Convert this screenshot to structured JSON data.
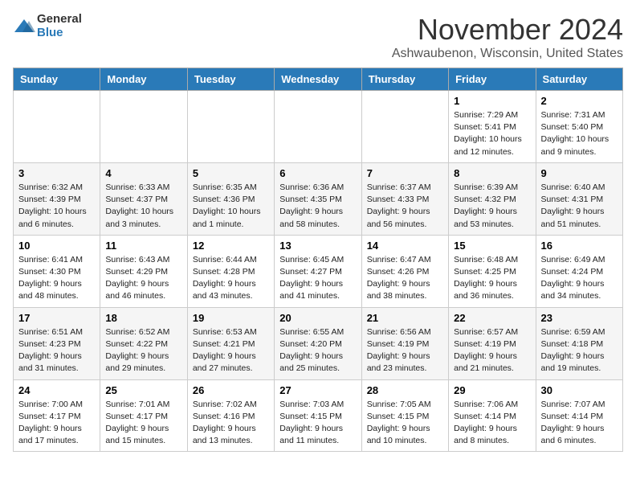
{
  "header": {
    "logo_general": "General",
    "logo_blue": "Blue",
    "month_title": "November 2024",
    "location": "Ashwaubenon, Wisconsin, United States"
  },
  "weekdays": [
    "Sunday",
    "Monday",
    "Tuesday",
    "Wednesday",
    "Thursday",
    "Friday",
    "Saturday"
  ],
  "weeks": [
    [
      {
        "day": "",
        "info": ""
      },
      {
        "day": "",
        "info": ""
      },
      {
        "day": "",
        "info": ""
      },
      {
        "day": "",
        "info": ""
      },
      {
        "day": "",
        "info": ""
      },
      {
        "day": "1",
        "info": "Sunrise: 7:29 AM\nSunset: 5:41 PM\nDaylight: 10 hours and 12 minutes."
      },
      {
        "day": "2",
        "info": "Sunrise: 7:31 AM\nSunset: 5:40 PM\nDaylight: 10 hours and 9 minutes."
      }
    ],
    [
      {
        "day": "3",
        "info": "Sunrise: 6:32 AM\nSunset: 4:39 PM\nDaylight: 10 hours and 6 minutes."
      },
      {
        "day": "4",
        "info": "Sunrise: 6:33 AM\nSunset: 4:37 PM\nDaylight: 10 hours and 3 minutes."
      },
      {
        "day": "5",
        "info": "Sunrise: 6:35 AM\nSunset: 4:36 PM\nDaylight: 10 hours and 1 minute."
      },
      {
        "day": "6",
        "info": "Sunrise: 6:36 AM\nSunset: 4:35 PM\nDaylight: 9 hours and 58 minutes."
      },
      {
        "day": "7",
        "info": "Sunrise: 6:37 AM\nSunset: 4:33 PM\nDaylight: 9 hours and 56 minutes."
      },
      {
        "day": "8",
        "info": "Sunrise: 6:39 AM\nSunset: 4:32 PM\nDaylight: 9 hours and 53 minutes."
      },
      {
        "day": "9",
        "info": "Sunrise: 6:40 AM\nSunset: 4:31 PM\nDaylight: 9 hours and 51 minutes."
      }
    ],
    [
      {
        "day": "10",
        "info": "Sunrise: 6:41 AM\nSunset: 4:30 PM\nDaylight: 9 hours and 48 minutes."
      },
      {
        "day": "11",
        "info": "Sunrise: 6:43 AM\nSunset: 4:29 PM\nDaylight: 9 hours and 46 minutes."
      },
      {
        "day": "12",
        "info": "Sunrise: 6:44 AM\nSunset: 4:28 PM\nDaylight: 9 hours and 43 minutes."
      },
      {
        "day": "13",
        "info": "Sunrise: 6:45 AM\nSunset: 4:27 PM\nDaylight: 9 hours and 41 minutes."
      },
      {
        "day": "14",
        "info": "Sunrise: 6:47 AM\nSunset: 4:26 PM\nDaylight: 9 hours and 38 minutes."
      },
      {
        "day": "15",
        "info": "Sunrise: 6:48 AM\nSunset: 4:25 PM\nDaylight: 9 hours and 36 minutes."
      },
      {
        "day": "16",
        "info": "Sunrise: 6:49 AM\nSunset: 4:24 PM\nDaylight: 9 hours and 34 minutes."
      }
    ],
    [
      {
        "day": "17",
        "info": "Sunrise: 6:51 AM\nSunset: 4:23 PM\nDaylight: 9 hours and 31 minutes."
      },
      {
        "day": "18",
        "info": "Sunrise: 6:52 AM\nSunset: 4:22 PM\nDaylight: 9 hours and 29 minutes."
      },
      {
        "day": "19",
        "info": "Sunrise: 6:53 AM\nSunset: 4:21 PM\nDaylight: 9 hours and 27 minutes."
      },
      {
        "day": "20",
        "info": "Sunrise: 6:55 AM\nSunset: 4:20 PM\nDaylight: 9 hours and 25 minutes."
      },
      {
        "day": "21",
        "info": "Sunrise: 6:56 AM\nSunset: 4:19 PM\nDaylight: 9 hours and 23 minutes."
      },
      {
        "day": "22",
        "info": "Sunrise: 6:57 AM\nSunset: 4:19 PM\nDaylight: 9 hours and 21 minutes."
      },
      {
        "day": "23",
        "info": "Sunrise: 6:59 AM\nSunset: 4:18 PM\nDaylight: 9 hours and 19 minutes."
      }
    ],
    [
      {
        "day": "24",
        "info": "Sunrise: 7:00 AM\nSunset: 4:17 PM\nDaylight: 9 hours and 17 minutes."
      },
      {
        "day": "25",
        "info": "Sunrise: 7:01 AM\nSunset: 4:17 PM\nDaylight: 9 hours and 15 minutes."
      },
      {
        "day": "26",
        "info": "Sunrise: 7:02 AM\nSunset: 4:16 PM\nDaylight: 9 hours and 13 minutes."
      },
      {
        "day": "27",
        "info": "Sunrise: 7:03 AM\nSunset: 4:15 PM\nDaylight: 9 hours and 11 minutes."
      },
      {
        "day": "28",
        "info": "Sunrise: 7:05 AM\nSunset: 4:15 PM\nDaylight: 9 hours and 10 minutes."
      },
      {
        "day": "29",
        "info": "Sunrise: 7:06 AM\nSunset: 4:14 PM\nDaylight: 9 hours and 8 minutes."
      },
      {
        "day": "30",
        "info": "Sunrise: 7:07 AM\nSunset: 4:14 PM\nDaylight: 9 hours and 6 minutes."
      }
    ]
  ]
}
